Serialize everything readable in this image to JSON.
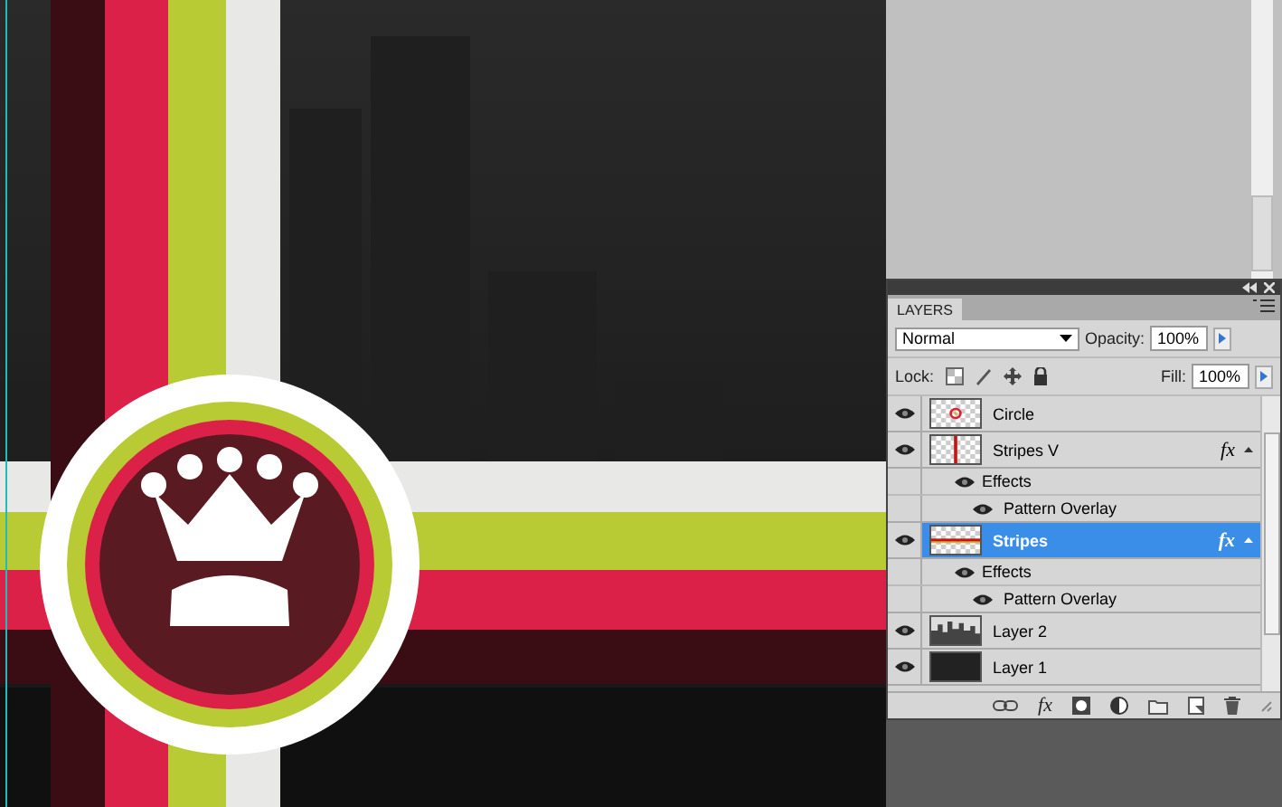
{
  "panel": {
    "title": "LAYERS",
    "blend_mode": "Normal",
    "opacity_label": "Opacity:",
    "opacity": "100%",
    "lock_label": "Lock:",
    "fill_label": "Fill:",
    "fill": "100%"
  },
  "layers": [
    {
      "name": "Circle",
      "visible": true,
      "selected": false,
      "kind": "circle"
    },
    {
      "name": "Stripes V",
      "visible": true,
      "selected": false,
      "kind": "vline",
      "fx": "fx",
      "effects": [
        {
          "name": "Effects",
          "visible": true,
          "children": [
            {
              "name": "Pattern Overlay",
              "visible": true
            }
          ]
        }
      ]
    },
    {
      "name": "Stripes",
      "visible": true,
      "selected": true,
      "kind": "hline",
      "fx": "fx",
      "effects": [
        {
          "name": "Effects",
          "visible": true,
          "children": [
            {
              "name": "Pattern Overlay",
              "visible": true
            }
          ]
        }
      ]
    },
    {
      "name": "Layer 2",
      "visible": true,
      "selected": false,
      "kind": "city"
    },
    {
      "name": "Layer 1",
      "visible": true,
      "selected": false,
      "kind": "dark"
    }
  ],
  "toolbar": [
    {
      "kind": "link"
    },
    {
      "kind": "fx",
      "label": "fx"
    },
    {
      "kind": "mask"
    },
    {
      "kind": "adjust"
    },
    {
      "kind": "folder"
    },
    {
      "kind": "new"
    },
    {
      "kind": "trash"
    }
  ]
}
